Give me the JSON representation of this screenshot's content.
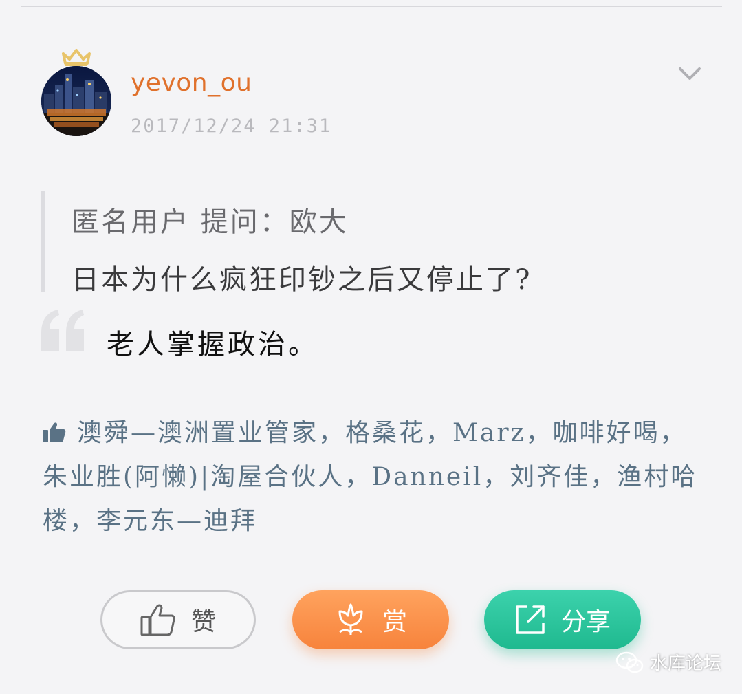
{
  "post": {
    "username": "yevon_ou",
    "timestamp": "2017/12/24 21:31"
  },
  "question": {
    "line1": "匿名用户  提问：欧大",
    "line2": "日本为什么疯狂印钞之后又停止了?"
  },
  "answer": {
    "text": "老人掌握政治。"
  },
  "likes": {
    "names": "澳舜—澳洲置业管家，格桑花，Marz，咖啡好喝，朱业胜(阿懒)|淘屋合伙人，Danneil，刘齐佳，渔村哈楼，李元东—迪拜"
  },
  "actions": {
    "like_label": "赞",
    "reward_label": "赏",
    "share_label": "分享"
  },
  "watermark": {
    "text": "水库论坛"
  },
  "colors": {
    "username": "#e0712c",
    "reward": "#f7833c",
    "share": "#1fb98f",
    "likes_text": "#5a7285"
  },
  "icons": {
    "crown": "crown-icon",
    "chevron": "chevron-down-icon",
    "quote": "quote-icon",
    "thumb": "thumbs-up-icon",
    "flower": "flower-icon",
    "share": "share-icon",
    "wechat": "wechat-icon"
  }
}
